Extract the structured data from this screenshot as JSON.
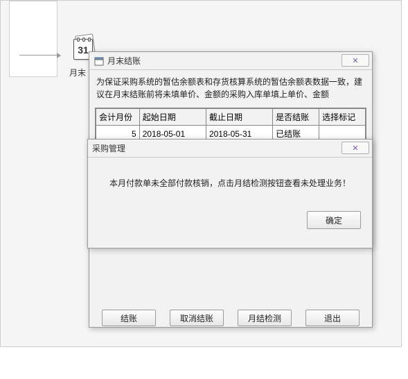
{
  "icon_label": "月末",
  "calendar_day": "31",
  "main_window": {
    "title": "月末结账",
    "notice": "为保证采购系统的暂估余额表和存货核算系统的暂估余额表数据一致，建议在月末结账前将未填单价、金额的采购入库单填上单价、金额",
    "table": {
      "headers": [
        "会计月份",
        "起始日期",
        "截止日期",
        "是否结账",
        "选择标记"
      ],
      "rows": [
        {
          "period": "5",
          "start": "2018-05-01",
          "end": "2018-05-31",
          "status": "已结账",
          "mark": ""
        }
      ]
    },
    "buttons": {
      "close": "结账",
      "cancel_close": "取消结账",
      "check": "月结检测",
      "exit": "退出"
    }
  },
  "modal": {
    "title": "采购管理",
    "message": "本月付款单未全部付款核销，点击月结检测按钮查看未处理业务！",
    "ok": "确定"
  }
}
